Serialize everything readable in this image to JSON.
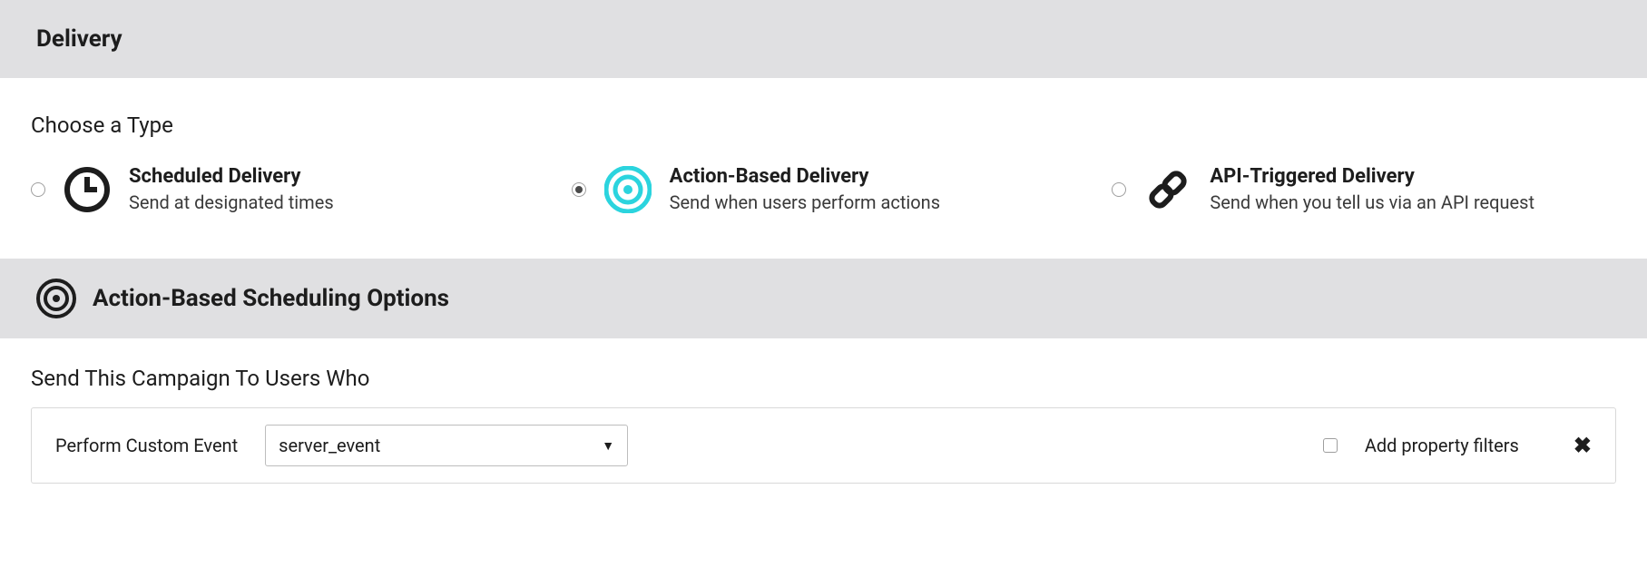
{
  "header": {
    "title": "Delivery"
  },
  "choose": {
    "label": "Choose a Type"
  },
  "options": {
    "scheduled": {
      "title": "Scheduled Delivery",
      "sub": "Send at designated times",
      "selected": false
    },
    "action": {
      "title": "Action-Based Delivery",
      "sub": "Send when users perform actions",
      "selected": true
    },
    "api": {
      "title": "API-Triggered Delivery",
      "sub": "Send when you tell us via an API request",
      "selected": false
    }
  },
  "subheader": {
    "title": "Action-Based Scheduling Options"
  },
  "trigger": {
    "label": "Send This Campaign To Users Who",
    "condition_label": "Perform Custom Event",
    "selected_event": "server_event",
    "filter_label": "Add property filters",
    "filter_checked": false
  },
  "colors": {
    "accent": "#2bd4de",
    "dark": "#1d1d1d",
    "bg_header": "#e0e0e2"
  }
}
